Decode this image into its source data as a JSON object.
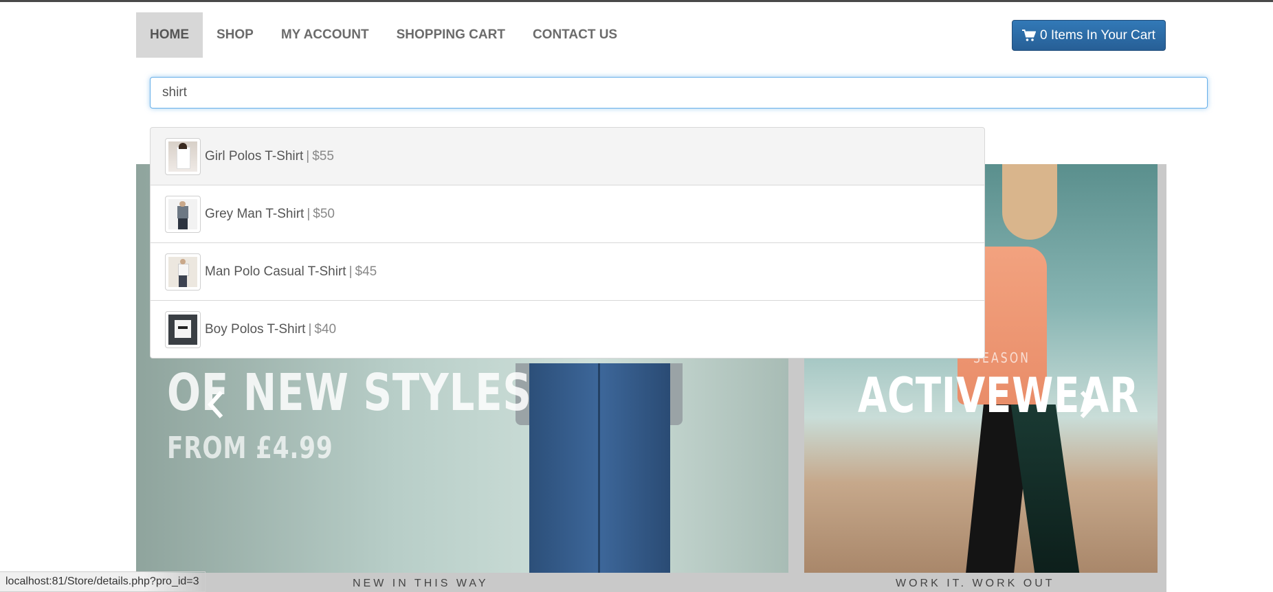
{
  "nav": {
    "items": [
      {
        "label": "HOME",
        "active": true
      },
      {
        "label": "SHOP",
        "active": false
      },
      {
        "label": "MY ACCOUNT",
        "active": false
      },
      {
        "label": "SHOPPING CART",
        "active": false
      },
      {
        "label": "CONTACT US",
        "active": false
      }
    ],
    "cart_button": {
      "label": "0 Items In Your Cart",
      "icon": "shopping-cart-icon",
      "color": "#2c6aa5"
    }
  },
  "search": {
    "value": "shirt",
    "focus_color": "#66afe9"
  },
  "suggestions": [
    {
      "name": "Girl Polos T-Shirt",
      "separator": "|",
      "price": "$55",
      "highlighted": true,
      "thumb_color": "#e8e8e8"
    },
    {
      "name": "Grey Man T-Shirt",
      "separator": "|",
      "price": "$50",
      "highlighted": false,
      "thumb_color": "#6d7884"
    },
    {
      "name": "Man Polo Casual T-Shirt",
      "separator": "|",
      "price": "$45",
      "highlighted": false,
      "thumb_color": "#d9d4cc"
    },
    {
      "name": "Boy Polos T-Shirt",
      "separator": "|",
      "price": "$40",
      "highlighted": false,
      "thumb_color": "#f0f0f0"
    }
  ],
  "banner": {
    "left_headline": "OF NEW STYLES",
    "left_price": "FROM £4.99",
    "left_caption": "NEW IN THIS WAY",
    "right_kicker": "SEASON",
    "right_headline": "ACTIVEWEAR",
    "right_caption": "WORK IT. WORK OUT",
    "prev_icon": "chevron-left-icon",
    "next_icon": "chevron-right-icon"
  },
  "status_bar": {
    "url": "localhost:81/Store/details.php?pro_id=3"
  }
}
